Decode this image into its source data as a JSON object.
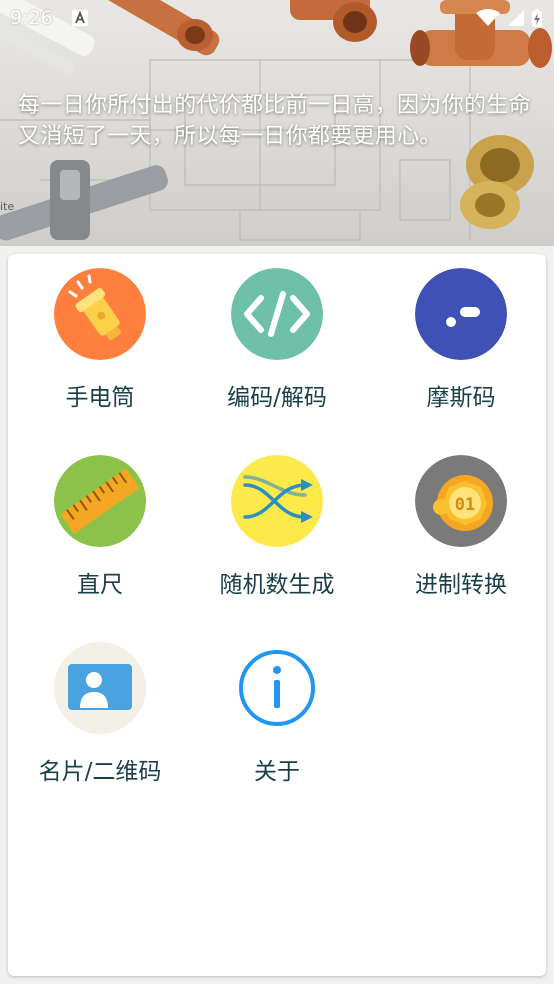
{
  "status_bar": {
    "time": "9:26",
    "notification_icon": "letter-a-notification-icon",
    "wifi_icon": "wifi-icon",
    "signal_icon": "cell-signal-icon",
    "battery_icon": "battery-charging-icon"
  },
  "banner": {
    "quote": "每一日你所付出的代价都比前一日高，因为你的生命又消短了一天，所以每一日你都要更用心。"
  },
  "colors": {
    "label_text": "#1a3f4a",
    "flashlight_bg": "#ff7f3f",
    "code_bg": "#6fc0a8",
    "morse_bg": "#3f51b5",
    "ruler_bg": "#8bc34a",
    "random_bg": "#fde94a",
    "base_bg": "#7a7a7a",
    "card_bg": "#f3f0e6",
    "about_stroke": "#2196f3"
  },
  "tools": [
    {
      "label": "手电筒",
      "icon": "flashlight-icon"
    },
    {
      "label": "编码/解码",
      "icon": "code-brackets-icon"
    },
    {
      "label": "摩斯码",
      "icon": "morse-dot-dash-icon"
    },
    {
      "label": "直尺",
      "icon": "ruler-icon"
    },
    {
      "label": "随机数生成",
      "icon": "shuffle-icon"
    },
    {
      "label": "进制转换",
      "icon": "binary-coin-icon"
    },
    {
      "label": "名片/二维码",
      "icon": "business-card-icon"
    },
    {
      "label": "关于",
      "icon": "info-icon"
    }
  ]
}
